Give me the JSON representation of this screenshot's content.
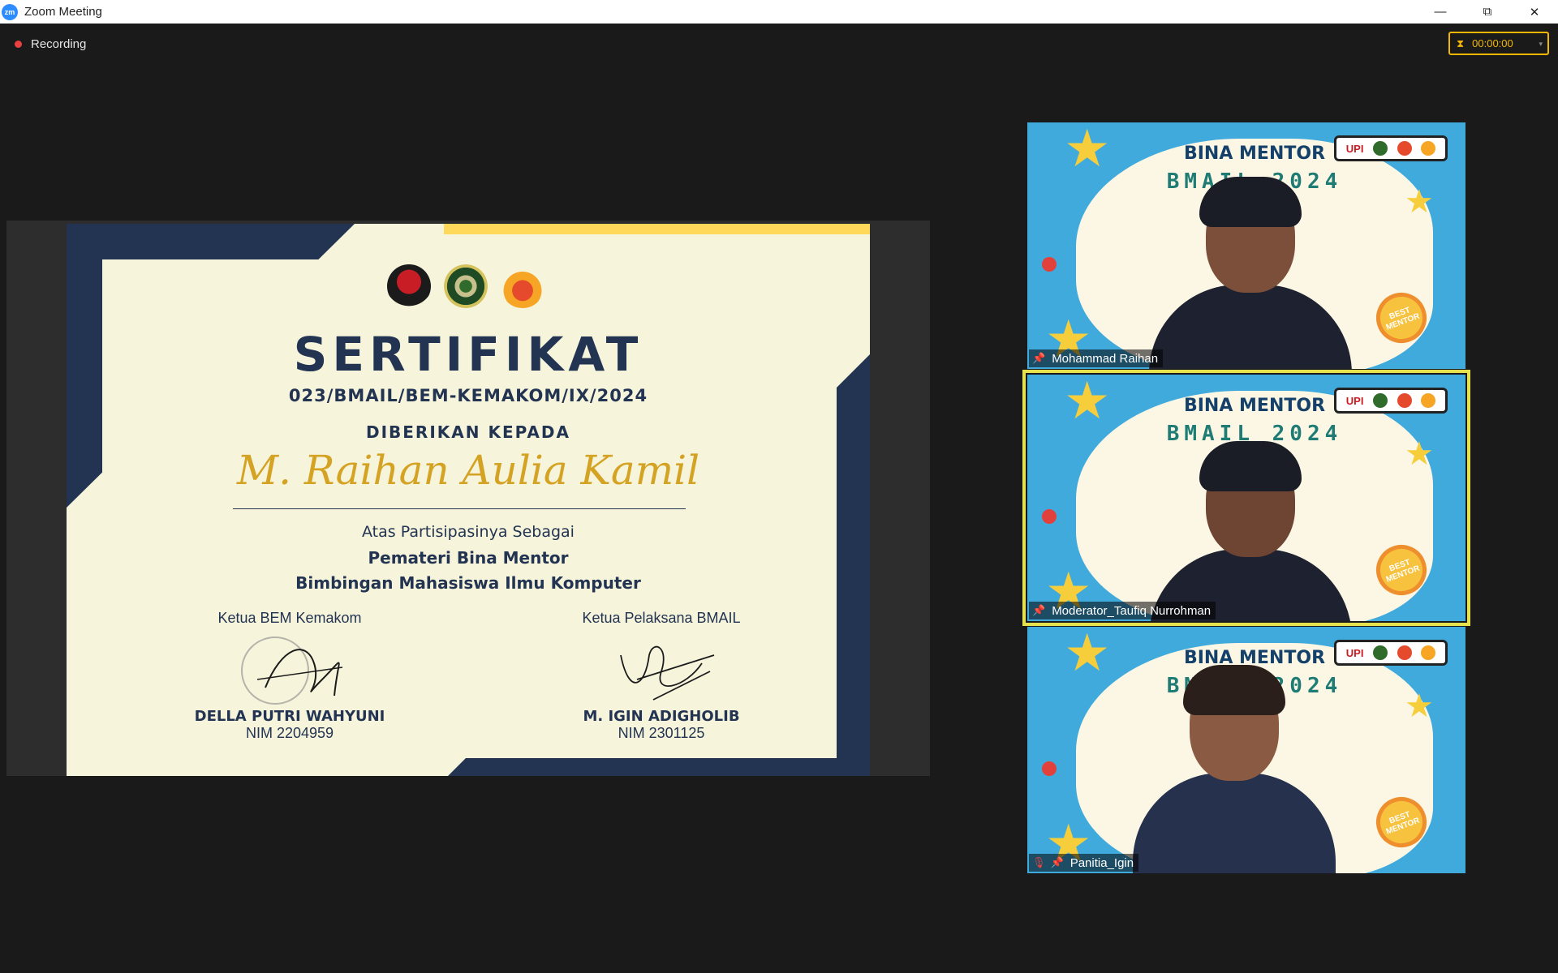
{
  "window": {
    "app_icon": "zm",
    "title": "Zoom Meeting",
    "minimize": "—",
    "restore": "⧉",
    "close": "✕"
  },
  "recording": {
    "label": "Recording"
  },
  "timer": {
    "value": "00:00:00",
    "icon": "⧗",
    "caret": "▾"
  },
  "certificate": {
    "title": "SERTIFIKAT",
    "number": "023/BMAIL/BEM-KEMAKOM/IX/2024",
    "given_to": "DIBERIKAN KEPADA",
    "recipient": "M. Raihan Aulia Kamil",
    "participation": "Atas Partisipasinya Sebagai",
    "role": "Pemateri Bina Mentor",
    "program": "Bimbingan Mahasiswa Ilmu Komputer",
    "signatories": [
      {
        "role": "Ketua BEM Kemakom",
        "name": "DELLA PUTRI WAHYUNI",
        "nim": "NIM 2204959"
      },
      {
        "role": "Ketua Pelaksana BMAIL",
        "name": "M. IGIN ADIGHOLIB",
        "nim": "NIM 2301125"
      }
    ]
  },
  "tile_background": {
    "heading": "BINA MENTOR",
    "subheading": "BMAIL 2024",
    "badge": "BEST MENTOR",
    "logo_text": "UPI"
  },
  "participants": [
    {
      "name": "Mohammad Raihan",
      "muted": false,
      "active": false
    },
    {
      "name": "Moderator_Taufiq Nurrohman",
      "muted": false,
      "active": true
    },
    {
      "name": "Panitia_Igin",
      "muted": true,
      "active": false
    }
  ],
  "colors": {
    "accent": "#f2b705",
    "navy": "#223452",
    "gold": "#d4a323",
    "tile_blue": "#40aadd",
    "active_speaker": "#e6e24e"
  }
}
